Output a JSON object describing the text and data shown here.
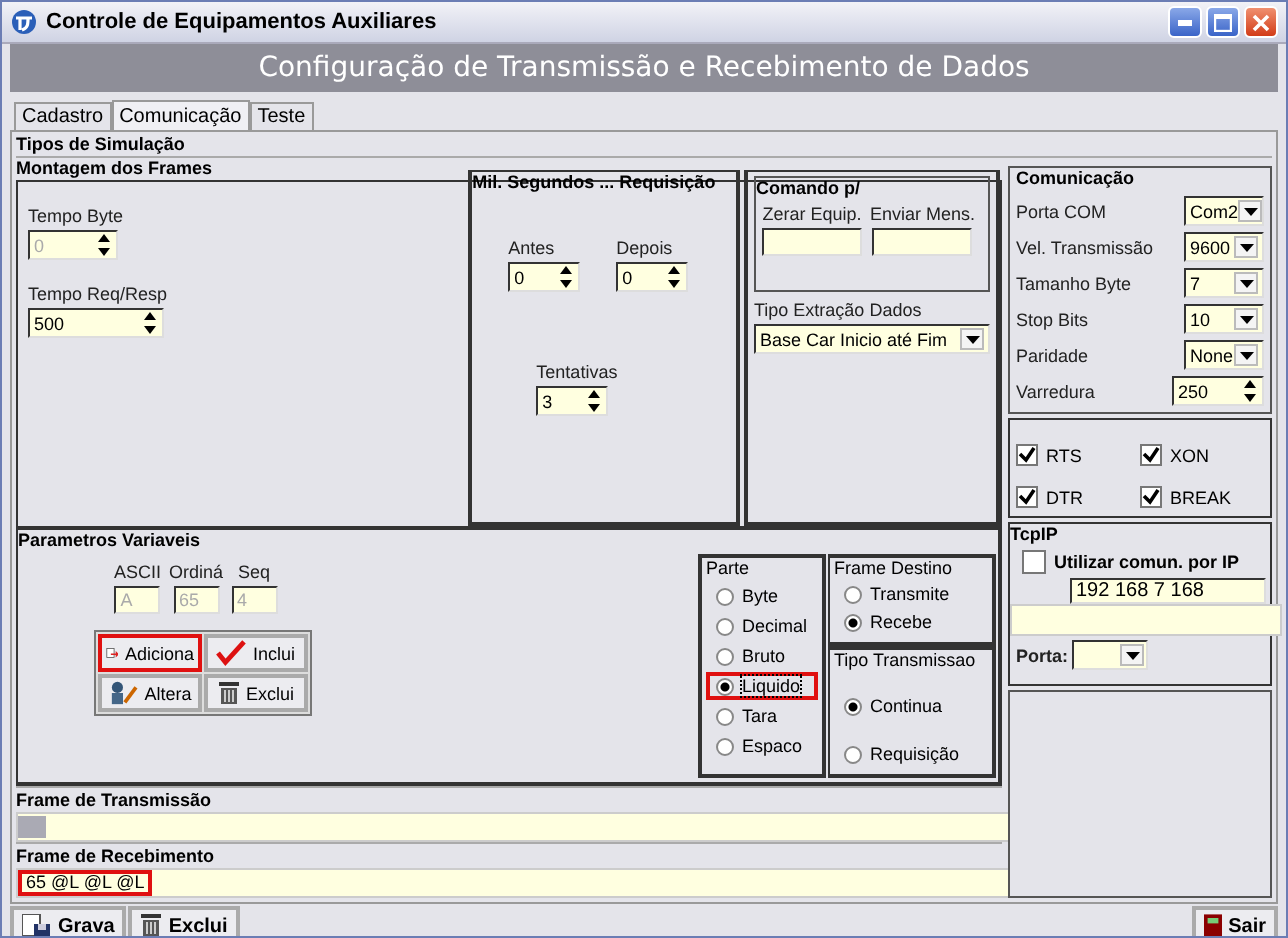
{
  "window": {
    "title": "Controle de Equipamentos Auxiliares"
  },
  "header": "Configuração de Transmissão e Recebimento de Dados",
  "tabs": [
    {
      "label": "Cadastro",
      "selected": false
    },
    {
      "label": "Comunicação",
      "selected": true
    },
    {
      "label": "Teste",
      "selected": false
    }
  ],
  "simulation_title": "Tipos de Simulação",
  "montagem": {
    "title": "Montagem dos Frames",
    "spinners": [
      {
        "label": "Tempo Byte",
        "value": "0",
        "disabled": true
      },
      {
        "label": "Tempo Req/Resp",
        "value": "500",
        "disabled": false
      }
    ],
    "mil_segundos": {
      "title": "Mil. Segundos ... Requisição",
      "spinners": [
        {
          "label": "Antes",
          "value": "0"
        },
        {
          "label": "Depois",
          "value": "0"
        },
        {
          "label": "Tentativas",
          "value": "3"
        }
      ]
    },
    "comando": {
      "title": "Comando p/",
      "fields": [
        {
          "label": "Zerar Equip."
        },
        {
          "label": "Enviar Mens."
        }
      ]
    },
    "extracao": {
      "label": "Tipo Extração Dados",
      "value": "Base Car Inicio até Fim"
    }
  },
  "parametros": {
    "title": "Parametros Variaveis",
    "fields": [
      {
        "label": "ASCII",
        "value": "A",
        "disabled": true
      },
      {
        "label": "Ordiná",
        "value": "65",
        "disabled": true
      },
      {
        "label": "Seq",
        "value": "4",
        "disabled": true
      }
    ],
    "buttons": [
      {
        "label": "Adiciona",
        "kind": "add",
        "highlighted": true
      },
      {
        "label": "Inclui",
        "kind": "check",
        "highlighted": false
      },
      {
        "label": "Altera",
        "kind": "edit",
        "highlighted": false
      },
      {
        "label": "Exclui",
        "kind": "trash",
        "highlighted": false
      }
    ],
    "parte": {
      "title": "Parte",
      "options": [
        {
          "label": "Byte",
          "selected": false,
          "highlighted": false
        },
        {
          "label": "Decimal",
          "selected": false,
          "highlighted": false
        },
        {
          "label": "Bruto",
          "selected": false,
          "highlighted": false
        },
        {
          "label": "Liquido",
          "selected": true,
          "highlighted": true
        },
        {
          "label": "Tara",
          "selected": false,
          "highlighted": false
        },
        {
          "label": "Espaco",
          "selected": false,
          "highlighted": false
        }
      ]
    },
    "destino": {
      "title": "Frame Destino",
      "options": [
        {
          "label": "Transmite",
          "selected": false
        },
        {
          "label": "Recebe",
          "selected": true
        }
      ]
    },
    "tipo": {
      "title": "Tipo Transmissao",
      "options": [
        {
          "label": "Continua",
          "selected": true
        },
        {
          "label": "Requisição",
          "selected": false
        }
      ]
    }
  },
  "frames": [
    {
      "title": "Frame de Transmissão"
    },
    {
      "title": "Frame de Recebimento",
      "value": "65 @L @L @L",
      "highlighted": true
    }
  ],
  "comunicacao": {
    "title": "Comunicação",
    "rows": [
      {
        "label": "Porta COM",
        "value": "Com2",
        "kind": "combo"
      },
      {
        "label": "Vel. Transmissão",
        "value": "9600",
        "kind": "combo"
      },
      {
        "label": "Tamanho Byte",
        "value": "7",
        "kind": "combo"
      },
      {
        "label": "Stop Bits",
        "value": "10",
        "kind": "combo"
      },
      {
        "label": "Paridade",
        "value": "None",
        "kind": "combo"
      },
      {
        "label": "Varredura",
        "value": "250",
        "kind": "spin"
      }
    ],
    "checks": [
      {
        "label": "RTS",
        "checked": true
      },
      {
        "label": "XON",
        "checked": true
      },
      {
        "label": "DTR",
        "checked": true
      },
      {
        "label": "BREAK",
        "checked": true
      }
    ]
  },
  "tcpip": {
    "title": "TcpIP",
    "use_ip": {
      "label": "Utilizar comun. por IP",
      "checked": false
    },
    "ip": "192 168 7 168",
    "porta_label": "Porta:"
  },
  "bottom_buttons": [
    {
      "label": "Grava",
      "kind": "save"
    },
    {
      "label": "Exclui",
      "kind": "trash"
    }
  ],
  "exit_button": {
    "label": "Sair"
  }
}
